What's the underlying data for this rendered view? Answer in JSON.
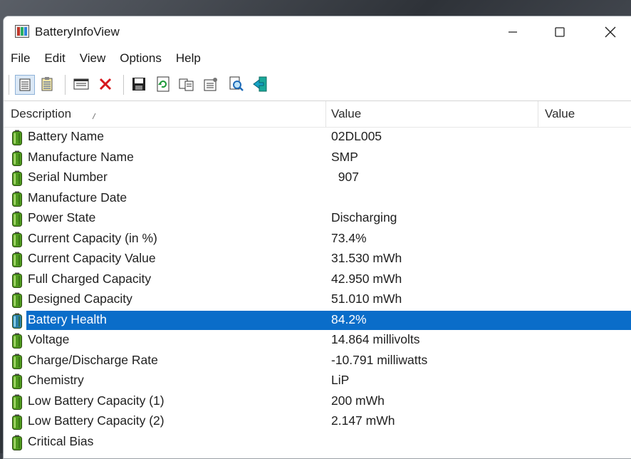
{
  "window": {
    "title": "BatteryInfoView"
  },
  "menu": [
    "File",
    "Edit",
    "View",
    "Options",
    "Help"
  ],
  "toolbar": [
    {
      "name": "details-view-icon",
      "active": true
    },
    {
      "name": "properties-list-icon",
      "active": false
    },
    {
      "name": "html-report-icon",
      "active": false
    },
    {
      "name": "delete-icon",
      "active": false
    },
    {
      "name": "save-icon",
      "active": false
    },
    {
      "name": "refresh-icon",
      "active": false
    },
    {
      "name": "copy-icon",
      "active": false
    },
    {
      "name": "properties-icon",
      "active": false
    },
    {
      "name": "find-icon",
      "active": false
    },
    {
      "name": "exit-icon",
      "active": false
    }
  ],
  "columns": {
    "description": "Description",
    "value": "Value",
    "value2": "Value"
  },
  "rows": [
    {
      "desc": "Battery Name",
      "value": "02DL005"
    },
    {
      "desc": "Manufacture Name",
      "value": "SMP"
    },
    {
      "desc": "Serial Number",
      "value": "  907"
    },
    {
      "desc": "Manufacture Date",
      "value": ""
    },
    {
      "desc": "Power State",
      "value": "Discharging"
    },
    {
      "desc": "Current Capacity (in %)",
      "value": "73.4%"
    },
    {
      "desc": "Current Capacity Value",
      "value": "31.530 mWh"
    },
    {
      "desc": "Full Charged Capacity",
      "value": "42.950 mWh"
    },
    {
      "desc": "Designed Capacity",
      "value": "51.010 mWh"
    },
    {
      "desc": "Battery Health",
      "value": "84.2%",
      "selected": true
    },
    {
      "desc": "Voltage",
      "value": "14.864 millivolts"
    },
    {
      "desc": "Charge/Discharge Rate",
      "value": "-10.791 milliwatts"
    },
    {
      "desc": "Chemistry",
      "value": "LiP"
    },
    {
      "desc": "Low Battery Capacity (1)",
      "value": "200 mWh"
    },
    {
      "desc": "Low Battery Capacity (2)",
      "value": "2.147 mWh"
    },
    {
      "desc": "Critical Bias",
      "value": ""
    }
  ],
  "colors": {
    "selection": "#0a6dc9",
    "battery_green": "#4f9a1e"
  }
}
